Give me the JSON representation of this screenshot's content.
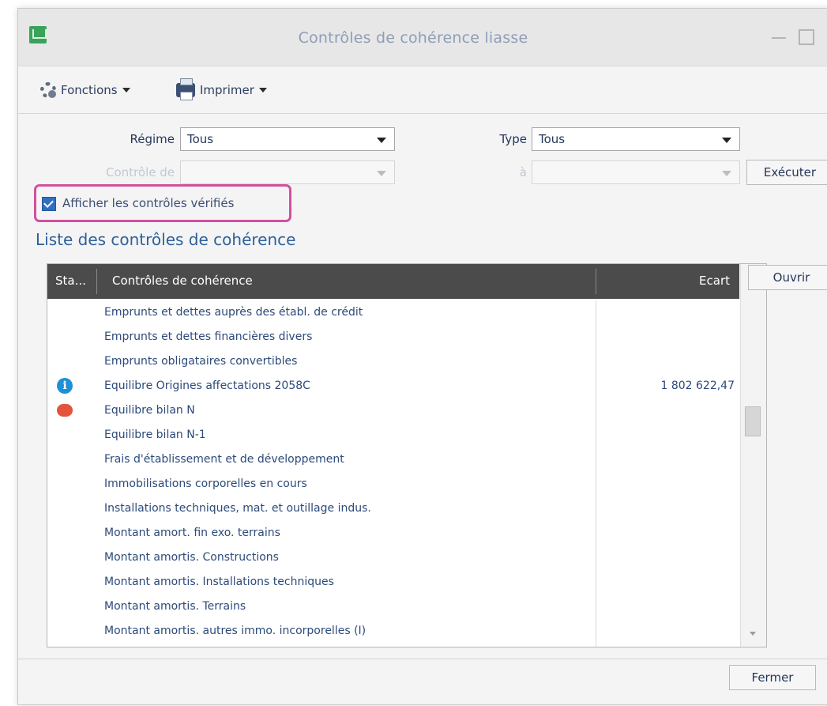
{
  "window": {
    "title": "Contrôles de cohérence liasse"
  },
  "toolbar": {
    "functions_label": "Fonctions",
    "print_label": "Imprimer"
  },
  "filters": {
    "regime_label": "Régime",
    "regime_value": "Tous",
    "type_label": "Type",
    "type_value": "Tous",
    "controle_label": "Contrôle de",
    "controle_value": "",
    "a_label": "à",
    "a_value": ""
  },
  "buttons": {
    "executer": "Exécuter",
    "ouvrir": "Ouvrir",
    "fermer": "Fermer"
  },
  "checkbox": {
    "label": "Afficher les contrôles vérifiés",
    "checked": true
  },
  "list": {
    "title": "Liste des contrôles de cohérence",
    "headers": {
      "status": "Sta...",
      "name": "Contrôles de cohérence",
      "ecart": "Ecart"
    },
    "rows": [
      {
        "status": "ok",
        "name": "Emprunts et dettes auprès des établ. de crédit",
        "ecart": ""
      },
      {
        "status": "ok",
        "name": "Emprunts et dettes financières divers",
        "ecart": ""
      },
      {
        "status": "ok",
        "name": "Emprunts obligataires convertibles",
        "ecart": ""
      },
      {
        "status": "info",
        "name": "Equilibre Origines affectations 2058C",
        "ecart": "1 802 622,47"
      },
      {
        "status": "error",
        "name": "Equilibre bilan N",
        "ecart": ""
      },
      {
        "status": "ok",
        "name": "Equilibre bilan N-1",
        "ecart": ""
      },
      {
        "status": "ok",
        "name": "Frais d'établissement et de développement",
        "ecart": ""
      },
      {
        "status": "ok",
        "name": "Immobilisations corporelles en cours",
        "ecart": ""
      },
      {
        "status": "ok",
        "name": "Installations techniques, mat. et outillage indus.",
        "ecart": ""
      },
      {
        "status": "ok",
        "name": "Montant amort. fin exo. terrains",
        "ecart": ""
      },
      {
        "status": "ok",
        "name": "Montant amortis. Constructions",
        "ecart": ""
      },
      {
        "status": "ok",
        "name": "Montant amortis. Installations techniques",
        "ecart": ""
      },
      {
        "status": "ok",
        "name": "Montant amortis. Terrains",
        "ecart": ""
      },
      {
        "status": "ok",
        "name": "Montant amortis. autres immo. incorporelles (I)",
        "ecart": ""
      }
    ]
  },
  "colors": {
    "highlight": "#d24fa0",
    "ok": "#39b54a",
    "info": "#1e90d6",
    "error": "#e5533b",
    "header_bg": "#4b4b4b"
  }
}
